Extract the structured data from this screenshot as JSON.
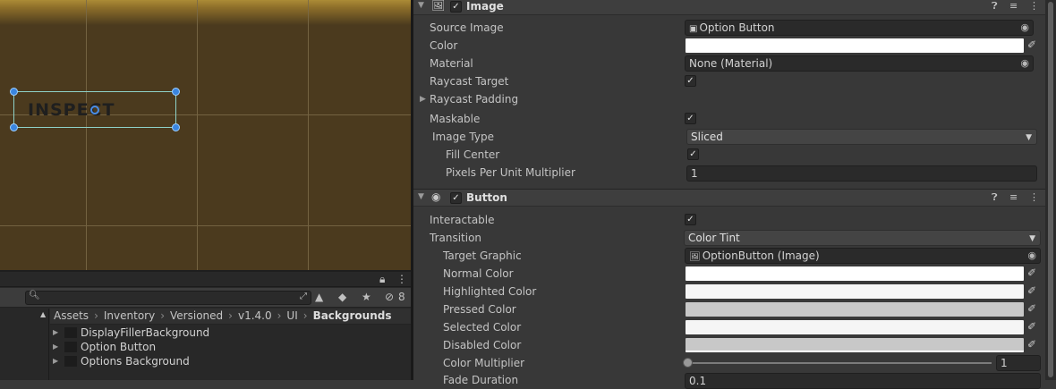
{
  "scene": {
    "text": "INSPECT"
  },
  "project": {
    "hidden_count": "8",
    "breadcrumb": [
      "Assets",
      "Inventory",
      "Versioned",
      "v1.4.0",
      "UI",
      "Backgrounds"
    ],
    "assets": [
      {
        "label": "DisplayFillerBackground"
      },
      {
        "label": "Option Button"
      },
      {
        "label": "Options Background"
      }
    ]
  },
  "inspector": {
    "image": {
      "title": "Image",
      "source_image_label": "Source Image",
      "source_image_value": "Option Button",
      "color_label": "Color",
      "color_value": "#ffffff",
      "material_label": "Material",
      "material_value": "None (Material)",
      "raycast_target_label": "Raycast Target",
      "raycast_padding_label": "Raycast Padding",
      "maskable_label": "Maskable",
      "image_type_label": "Image Type",
      "image_type_value": "Sliced",
      "fill_center_label": "Fill Center",
      "ppu_label": "Pixels Per Unit Multiplier",
      "ppu_value": "1"
    },
    "button": {
      "title": "Button",
      "interactable_label": "Interactable",
      "transition_label": "Transition",
      "transition_value": "Color Tint",
      "target_graphic_label": "Target Graphic",
      "target_graphic_value": "OptionButton (Image)",
      "normal_color_label": "Normal Color",
      "normal_color_value": "#ffffff",
      "highlighted_color_label": "Highlighted Color",
      "highlighted_color_value": "#f5f5f5",
      "pressed_color_label": "Pressed Color",
      "pressed_color_value": "#c8c8c8",
      "selected_color_label": "Selected Color",
      "selected_color_value": "#f5f5f5",
      "disabled_color_label": "Disabled Color",
      "disabled_color_value": "#c8c8c8",
      "color_multiplier_label": "Color Multiplier",
      "color_multiplier_value": "1",
      "color_multiplier_fraction": 0,
      "fade_duration_label": "Fade Duration",
      "fade_duration_value": "0.1"
    }
  }
}
